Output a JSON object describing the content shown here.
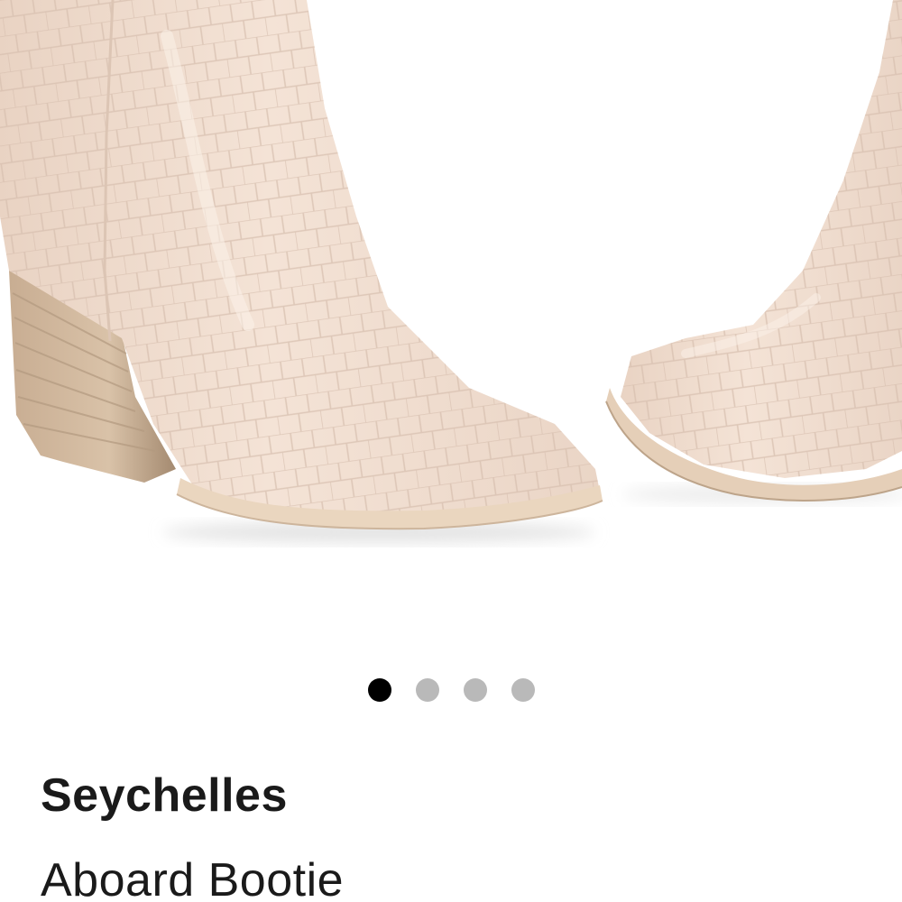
{
  "product": {
    "brand": "Seychelles",
    "name": "Aboard Bootie"
  },
  "gallery": {
    "image_alt": "Seychelles Aboard Bootie in cream croc-embossed leather",
    "image_count": 4,
    "active_index": 0,
    "dots": [
      {
        "label": "Image 1",
        "active": true
      },
      {
        "label": "Image 2",
        "active": false
      },
      {
        "label": "Image 3",
        "active": false
      },
      {
        "label": "Image 4",
        "active": false
      }
    ]
  },
  "colors": {
    "boot": "#f0ddd0",
    "heel_wood": "#cdb398",
    "dot_active": "#000000",
    "dot_inactive": "#b9b9b9",
    "text": "#1a1a1a"
  }
}
